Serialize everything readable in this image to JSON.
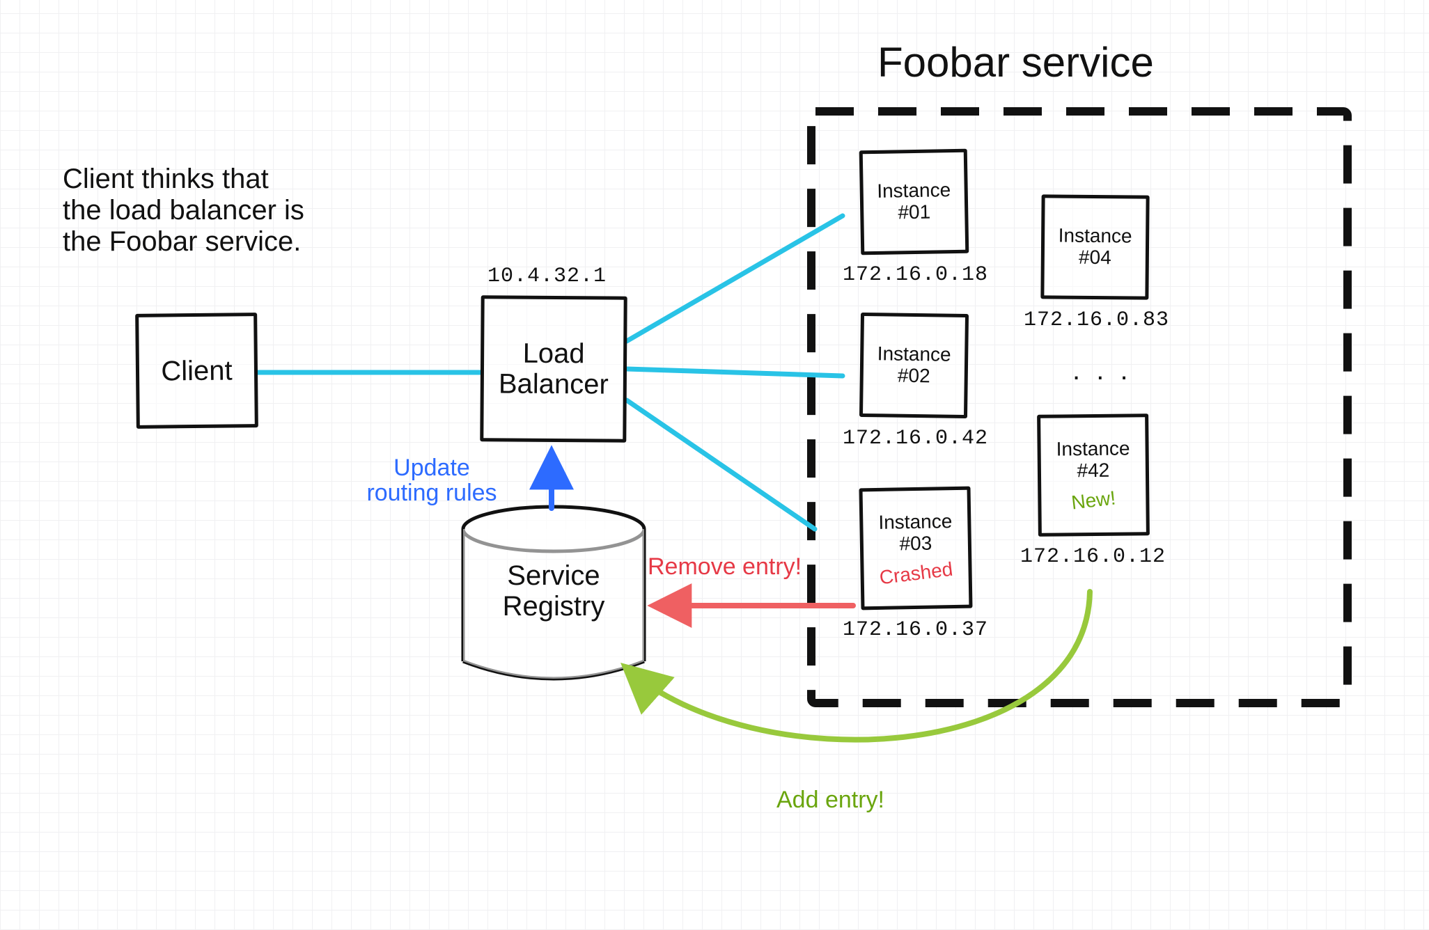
{
  "caption": {
    "line1": "Client thinks that",
    "line2": "the load balancer is",
    "line3": "the Foobar service."
  },
  "client": {
    "label": "Client"
  },
  "lb": {
    "ip": "10.4.32.1",
    "label_line1": "Load",
    "label_line2": "Balancer"
  },
  "registry": {
    "label_line1": "Service",
    "label_line2": "Registry",
    "update_line1": "Update",
    "update_line2": "routing rules"
  },
  "actions": {
    "remove": "Remove entry!",
    "add": "Add entry!"
  },
  "service": {
    "title": "Foobar service",
    "ellipsis": ". . .",
    "instances": [
      {
        "name_line1": "Instance",
        "name_line2": "#01",
        "ip": "172.16.0.18",
        "status": ""
      },
      {
        "name_line1": "Instance",
        "name_line2": "#02",
        "ip": "172.16.0.42",
        "status": ""
      },
      {
        "name_line1": "Instance",
        "name_line2": "#03",
        "ip": "172.16.0.37",
        "status": "Crashed"
      },
      {
        "name_line1": "Instance",
        "name_line2": "#04",
        "ip": "172.16.0.83",
        "status": ""
      },
      {
        "name_line1": "Instance",
        "name_line2": "#42",
        "ip": "172.16.0.12",
        "status": "New!"
      }
    ]
  },
  "colors": {
    "line_cyan": "#29c3e6",
    "line_blue": "#2d6bff",
    "line_red": "#ef6062",
    "line_green": "#98c93c",
    "ink": "#111111"
  }
}
